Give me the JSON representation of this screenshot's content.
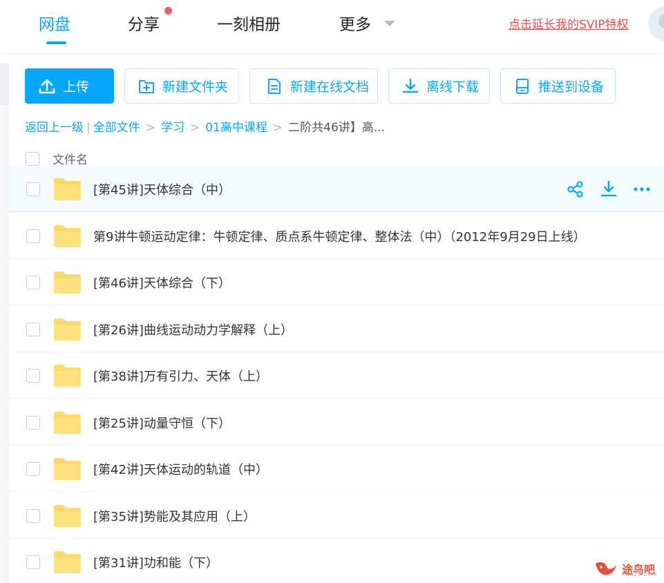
{
  "nav": {
    "tabs": [
      {
        "label": "网盘",
        "active": true
      },
      {
        "label": "分享",
        "badge": "red-dot"
      },
      {
        "label": "一刻相册"
      },
      {
        "label": "更多",
        "icon": "chevron-down-icon"
      }
    ],
    "svip_link": "点击延长我的SVIP特权"
  },
  "colors": {
    "accent": "#06a7ff",
    "folder": "#ffd86a",
    "svip_red": "#f04b4b",
    "badge_red": "#f25d5d"
  },
  "toolbar": {
    "upload": "上传",
    "new_folder": "新建文件夹",
    "new_doc": "新建在线文档",
    "offline_download": "离线下载",
    "push_device": "推送到设备"
  },
  "breadcrumb": {
    "back": "返回上一级",
    "items": [
      "全部文件",
      "学习",
      "01高中课程"
    ],
    "current": "二阶共46讲】高..."
  },
  "table": {
    "column_name": "文件名"
  },
  "files": [
    {
      "name": "[第45讲]天体综合（中）",
      "hovered": true
    },
    {
      "name": "第9讲牛顿运动定律：牛顿定律、质点系牛顿定律、整体法（中）（2012年9月29日上线）"
    },
    {
      "name": "[第46讲]天体综合（下）"
    },
    {
      "name": "[第26讲]曲线运动动力学解释（上）"
    },
    {
      "name": "[第38讲]万有引力、天体（上）"
    },
    {
      "name": "[第25讲]动量守恒（下）"
    },
    {
      "name": "[第42讲]天体运动的轨道（中）"
    },
    {
      "name": "[第35讲]势能及其应用（上）"
    },
    {
      "name": "[第31讲]功和能（下）"
    }
  ],
  "row_action_icons": [
    "share-icon",
    "download-icon",
    "more-icon"
  ],
  "watermark": {
    "text": "途鸟吧",
    "sub": "TNBZS.COM"
  }
}
